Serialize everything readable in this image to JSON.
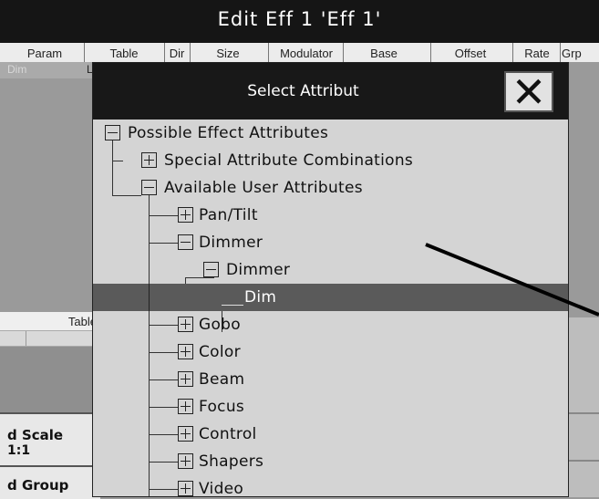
{
  "window": {
    "title": "Edit Eff 1 'Eff 1'"
  },
  "columns": [
    "Param",
    "Table",
    "Dir",
    "Size",
    "Modulator",
    "Base",
    "Offset",
    "Rate",
    "Grp"
  ],
  "background": {
    "row1_left": "Dim",
    "row1_cell2": "L",
    "table_header": "Table",
    "scale_label": "d  Scale",
    "scale_value": "1:1",
    "group_label": "d  Group"
  },
  "dialog": {
    "title": "Select Attribut",
    "close_glyph": "✕",
    "tree": [
      {
        "label": "Possible Effect Attributes",
        "state": "expanded"
      },
      {
        "label": "Special Attribute Combinations",
        "state": "collapsed"
      },
      {
        "label": "Available User Attributes",
        "state": "expanded"
      },
      {
        "label": "Pan/Tilt",
        "state": "collapsed"
      },
      {
        "label": "Dimmer",
        "state": "expanded"
      },
      {
        "label": "Dimmer",
        "state": "expanded"
      },
      {
        "label": "Dim",
        "state": "leaf",
        "selected": true
      },
      {
        "label": "Gobo",
        "state": "collapsed"
      },
      {
        "label": "Color",
        "state": "collapsed"
      },
      {
        "label": "Beam",
        "state": "collapsed"
      },
      {
        "label": "Focus",
        "state": "collapsed"
      },
      {
        "label": "Control",
        "state": "collapsed"
      },
      {
        "label": "Shapers",
        "state": "collapsed"
      },
      {
        "label": "Video",
        "state": "collapsed"
      }
    ]
  },
  "colors": {
    "title_bg": "#151515",
    "dialog_bg": "#d4d4d4",
    "selection_bg": "#5a5a5a"
  }
}
